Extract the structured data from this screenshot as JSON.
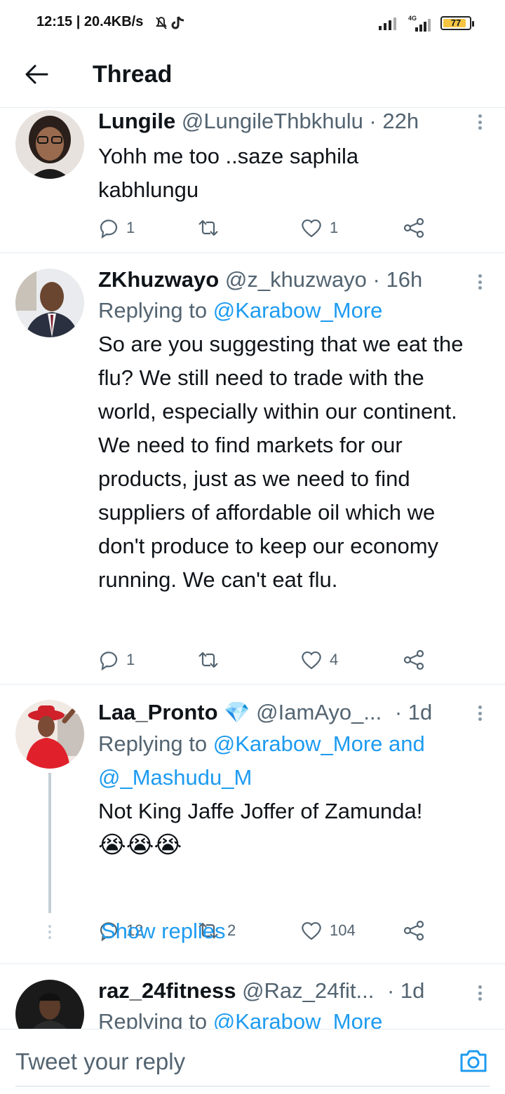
{
  "status_bar": {
    "time": "12:15 | 20.4KB/s",
    "battery": "77",
    "network": "4G"
  },
  "header": {
    "title": "Thread",
    "back_icon": "arrow-left-icon"
  },
  "tweets": [
    {
      "name": "Lungile",
      "handle": "@LungileThbkhulu · 22h",
      "replying_prefix": "",
      "replying_to": "",
      "text": "Yohh me too ..saze saphila kabhlungu",
      "replies": "1",
      "retweets": "",
      "likes": "1"
    },
    {
      "name": "ZKhuzwayo",
      "handle": "@z_khuzwayo · 16h",
      "replying_prefix": "Replying to",
      "replying_to": "@Karabow_More",
      "text": "So are you suggesting that we eat the flu? We still need to trade with the world, especially within our continent. We need to find markets for our products, just as we need to find suppliers of affordable oil which we don't produce to keep our economy running. We can't eat flu.",
      "replies": "1",
      "retweets": "",
      "likes": "4"
    },
    {
      "name": "Laa_Pronto",
      "badge": "💎",
      "handle": "@IamAyo_...",
      "time": "· 1d",
      "replying_prefix": "Replying to",
      "replying_to": "@Karabow_More and @_Mashudu_M",
      "text": "Not King Jaffe Joffer of Zamunda!",
      "emoji": "😭😭😭",
      "replies": "12",
      "retweets": "2",
      "likes": "104",
      "show_replies": "Show replies"
    },
    {
      "name": "raz_24fitness",
      "handle": "@Raz_24fit...",
      "time": "· 1d",
      "replying_prefix": "Replying to",
      "replying_to": "@Karabow_More"
    }
  ],
  "reply_bar": {
    "placeholder": "Tweet your reply",
    "camera_icon": "camera-icon"
  },
  "colors": {
    "link": "#1d9bf0",
    "secondary_text": "#536471",
    "divider": "#e6ecf0"
  }
}
